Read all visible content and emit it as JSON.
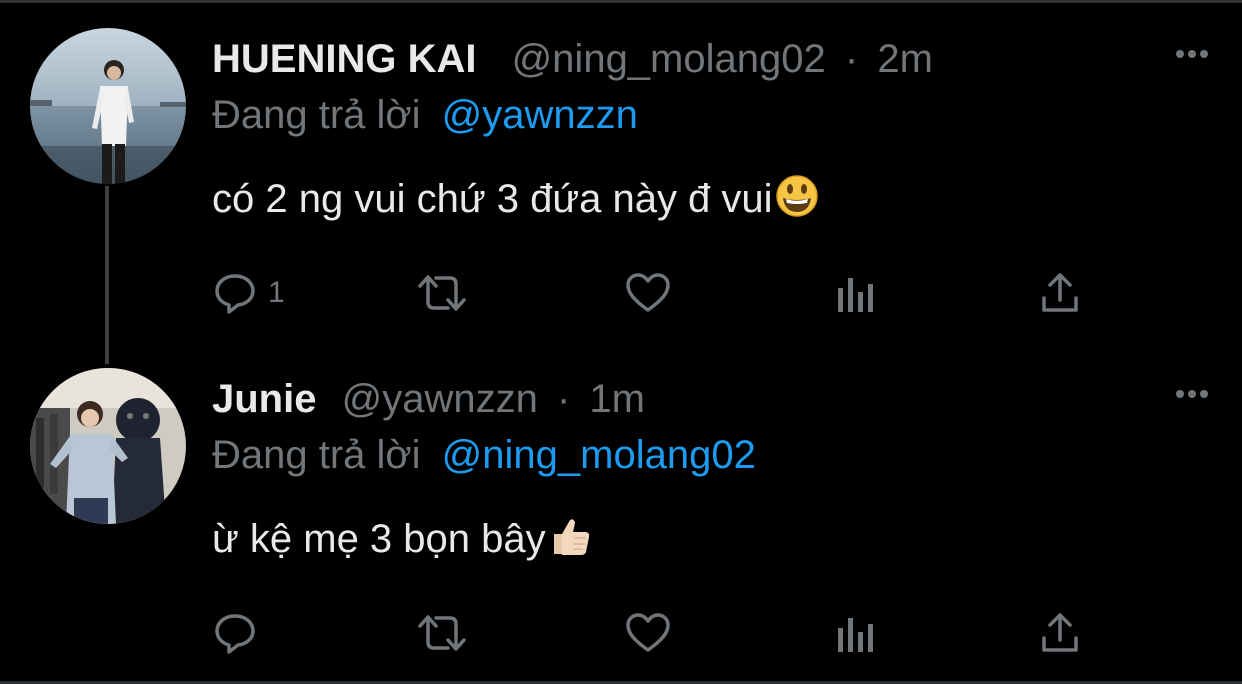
{
  "tweets": [
    {
      "display_name": "HUENING KAI",
      "handle": "@ning_molang02",
      "separator": "·",
      "time": "2m",
      "reply_prefix": "Đang trả lời",
      "reply_to": "@yawnzzn",
      "text": "có 2 ng vui chứ 3 đứa này đ vui",
      "emoji": "grinning-face",
      "reply_count": "1",
      "icons": [
        "reply-icon",
        "retweet-icon",
        "like-icon",
        "views-icon",
        "share-icon",
        "more-icon"
      ]
    },
    {
      "display_name": "Junie",
      "handle": "@yawnzzn",
      "separator": "·",
      "time": "1m",
      "reply_prefix": "Đang trả lời",
      "reply_to": "@ning_molang02",
      "text": "ừ kệ mẹ 3 bọn bây",
      "emoji": "thumbs-up-light-skin",
      "reply_count": "",
      "icons": [
        "reply-icon",
        "retweet-icon",
        "like-icon",
        "views-icon",
        "share-icon",
        "more-icon"
      ]
    }
  ],
  "colors": {
    "background": "#000000",
    "text": "#e7e9ea",
    "secondary": "#71767b",
    "link": "#1d9bf0",
    "thread_line": "#3e4144"
  }
}
